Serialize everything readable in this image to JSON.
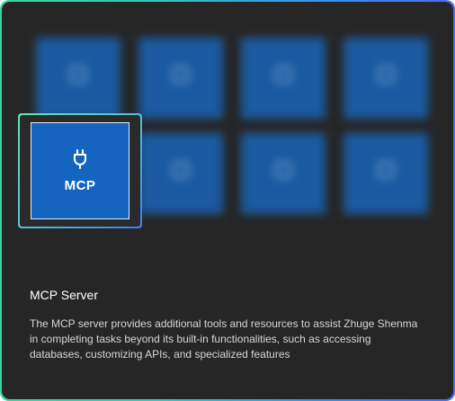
{
  "blurred_tiles": [
    {
      "label": ""
    },
    {
      "label": ""
    },
    {
      "label": ""
    },
    {
      "label": ""
    },
    {
      "label": ""
    },
    {
      "label": ""
    },
    {
      "label": ""
    },
    {
      "label": ""
    }
  ],
  "featured_tile": {
    "label": "MCP",
    "icon": "plug-icon"
  },
  "feature": {
    "title": "MCP Server",
    "description": "The MCP server provides additional tools and resources to assist Zhuge Shenma in completing tasks beyond its built-in functionalities, such as accessing databases, customizing APIs, and specialized features"
  },
  "colors": {
    "card_bg": "#262626",
    "tile_blue": "#1565c0",
    "blurred_tile": "#1b5aa0",
    "border_gradient_start": "#3dd59a",
    "border_gradient_end": "#4a6cf0"
  }
}
